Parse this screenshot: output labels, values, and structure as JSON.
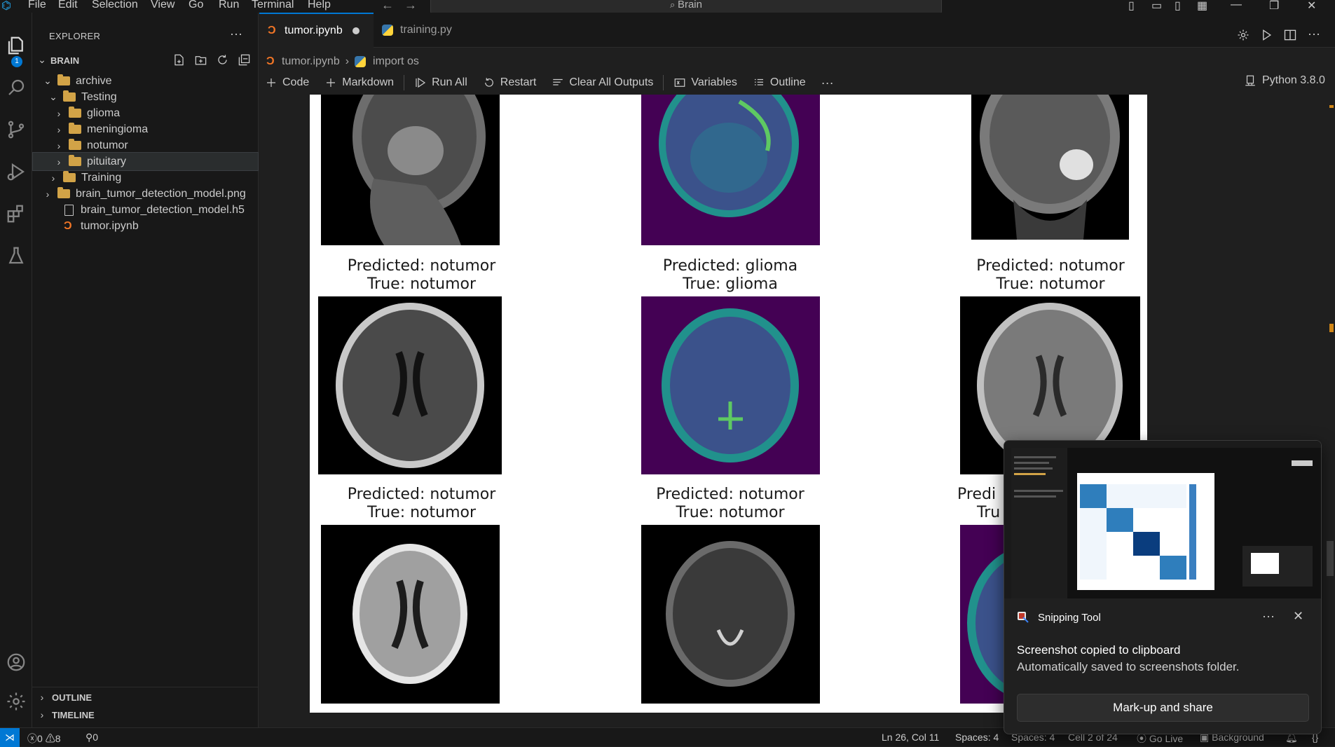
{
  "menu": [
    "File",
    "Edit",
    "Selection",
    "View",
    "Go",
    "Run",
    "Terminal",
    "Help"
  ],
  "search": {
    "label": "Brain"
  },
  "activity": {
    "explorer_badge": "1"
  },
  "sidebar": {
    "title": "EXPLORER",
    "more": "···",
    "workspace": "BRAIN",
    "tree": [
      {
        "label": "archive"
      },
      {
        "label": "Testing"
      },
      {
        "label": "glioma"
      },
      {
        "label": "meningioma"
      },
      {
        "label": "notumor"
      },
      {
        "label": "pituitary"
      },
      {
        "label": "Training"
      },
      {
        "label": "brain_tumor_detection_model.png"
      },
      {
        "label": "brain_tumor_detection_model.h5"
      },
      {
        "label": "tumor.ipynb"
      }
    ],
    "outline": "OUTLINE",
    "timeline": "TIMELINE"
  },
  "tabs": [
    {
      "label": "tumor.ipynb",
      "active": true,
      "dirty": true
    },
    {
      "label": "training.py",
      "active": false
    }
  ],
  "breadcrumb": {
    "file": "tumor.ipynb",
    "symbol": "import os"
  },
  "toolbar": {
    "code": "Code",
    "markdown": "Markdown",
    "run_all": "Run All",
    "restart": "Restart",
    "clear_outputs": "Clear All Outputs",
    "variables": "Variables",
    "outline": "Outline",
    "more": "···",
    "kernel": "Python 3.8.0"
  },
  "output": {
    "rows": [
      [
        {
          "predicted": "",
          "true": "",
          "cmap": "gray"
        },
        {
          "predicted": "",
          "true": "",
          "cmap": "viridis"
        },
        {
          "predicted": "",
          "true": "",
          "cmap": "gray"
        }
      ],
      [
        {
          "predicted": "Predicted: notumor",
          "true": "True: notumor",
          "cmap": "gray"
        },
        {
          "predicted": "Predicted: glioma",
          "true": "True: glioma",
          "cmap": "viridis"
        },
        {
          "predicted": "Predicted: notumor",
          "true": "True: notumor",
          "cmap": "gray"
        }
      ],
      [
        {
          "predicted": "Predicted: notumor",
          "true": "True: notumor",
          "cmap": "gray"
        },
        {
          "predicted": "Predicted: notumor",
          "true": "True: notumor",
          "cmap": "gray"
        },
        {
          "predicted": "Predi",
          "true": "Tru",
          "cmap": "viridis"
        }
      ]
    ]
  },
  "status": {
    "errors": "0",
    "warnings": "8",
    "ports": "0",
    "position": "Ln 26, Col 11",
    "spaces": "Spaces: 4",
    "spaces2": "Spaces: 4",
    "cell": "Cell 2 of 24",
    "golive": "Go Live",
    "background": "Background"
  },
  "toast": {
    "app": "Snipping Tool",
    "more": "···",
    "heading": "Screenshot copied to clipboard",
    "body": "Automatically saved to screenshots folder.",
    "button": "Mark-up and share"
  },
  "colors": {
    "accent": "#0078d4",
    "viridis_bg": "#440154",
    "viridis_mid": "#3b528b",
    "viridis_hi": "#21918c",
    "folder": "#d2a347",
    "notebook_icon": "#f37626"
  }
}
